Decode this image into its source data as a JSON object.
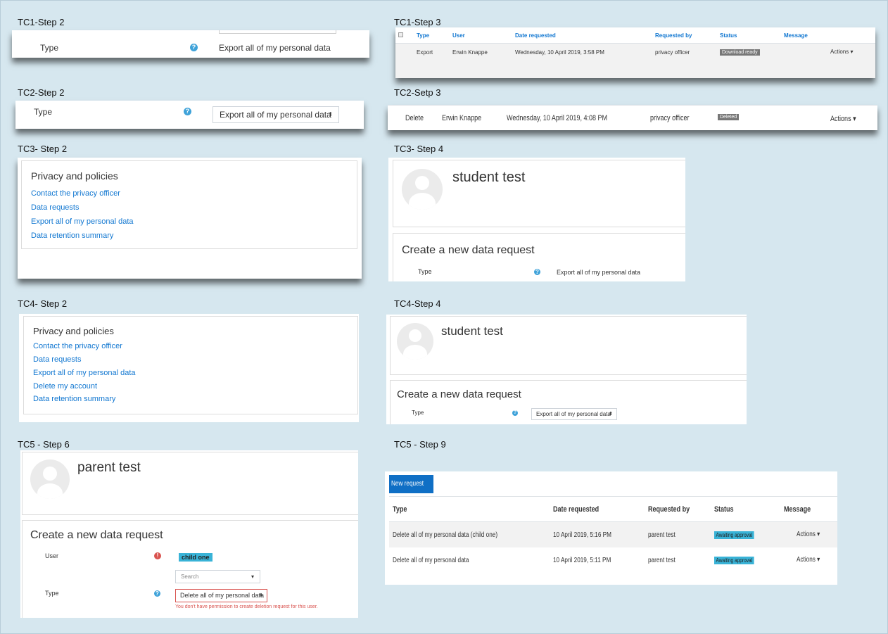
{
  "captions": {
    "tc1_step2": "TC1-Step 2",
    "tc1_step3": "TC1-Step 3",
    "tc2_step2": "TC2-Step 2",
    "tc2_step3": "TC2-Setp 3",
    "tc3_step2": "TC3- Step 2",
    "tc3_step4": "TC3- Step 4",
    "tc4_step2": "TC4- Step 2",
    "tc4_step4": "TC4-Step 4",
    "tc5_step6": "TC5 - Step 6",
    "tc5_step9": "TC5 - Step 9"
  },
  "tc1_step2": {
    "type_label": "Type",
    "value": "Export all of my personal data"
  },
  "tc1_step3": {
    "headers": [
      "Type",
      "User",
      "Date requested",
      "Requested by",
      "Status",
      "Message"
    ],
    "row": {
      "type": "Export",
      "user": "Erwin Knappe",
      "date": "Wednesday, 10 April 2019, 3:58 PM",
      "requested_by": "privacy officer",
      "status": "Download ready",
      "actions": "Actions"
    }
  },
  "tc2_step2": {
    "type_label": "Type",
    "value": "Export all of my personal data"
  },
  "tc2_step3": {
    "type": "Delete",
    "user": "Erwin Knappe",
    "date": "Wednesday, 10 April 2019, 4:08 PM",
    "requested_by": "privacy officer",
    "status": "Deleted",
    "actions": "Actions"
  },
  "tc3_step2": {
    "title": "Privacy and policies",
    "links": [
      "Contact the privacy officer",
      "Data requests",
      "Export all of my personal data",
      "Data retention summary"
    ]
  },
  "tc3_step4": {
    "name": "student test",
    "form_title": "Create a new data request",
    "type_label": "Type",
    "value": "Export all of my personal data"
  },
  "tc4_step2": {
    "title": "Privacy and policies",
    "links": [
      "Contact the privacy officer",
      "Data requests",
      "Export all of my personal data",
      "Delete my account",
      "Data retention summary"
    ]
  },
  "tc4_step4": {
    "name": "student test",
    "form_title": "Create a new data request",
    "type_label": "Type",
    "value": "Export all of my personal data"
  },
  "tc5_step6": {
    "name": "parent test",
    "form_title": "Create a new data request",
    "user_label": "User",
    "user_chip": "child one",
    "search_placeholder": "Search",
    "type_label": "Type",
    "type_value": "Delete all of my personal data",
    "error": "You don't have permission to create deletion request for this user."
  },
  "tc5_step9": {
    "new_request": "New request",
    "headers": [
      "Type",
      "Date requested",
      "Requested by",
      "Status",
      "Message"
    ],
    "rows": [
      {
        "type": "Delete all of my personal data (child one)",
        "date": "10 April 2019, 5:16 PM",
        "requested_by": "parent test",
        "status": "Awaiting approval",
        "actions": "Actions"
      },
      {
        "type": "Delete all of my personal data",
        "date": "10 April 2019, 5:11 PM",
        "requested_by": "parent test",
        "status": "Awaiting approval",
        "actions": "Actions"
      }
    ]
  },
  "icons": {
    "help": "?",
    "error": "!",
    "select_caret": "⬍",
    "dropdown_caret": "▾"
  },
  "colors": {
    "link": "#1177d1",
    "help_icon": "#3ea2d9",
    "badge_info": "#39b3d7",
    "badge_default": "#777777",
    "primary_button": "#0f6fc5",
    "error": "#d9534f",
    "page_bg": "#d6e7ef"
  }
}
